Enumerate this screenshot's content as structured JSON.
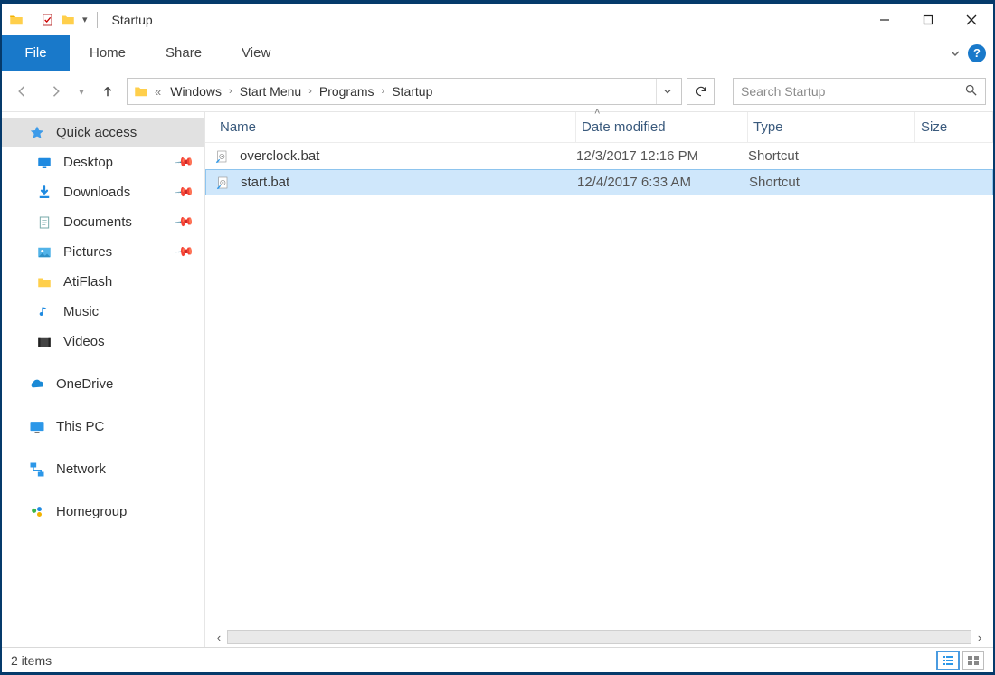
{
  "window": {
    "title": "Startup"
  },
  "ribbon": {
    "file": "File",
    "tabs": [
      "Home",
      "Share",
      "View"
    ]
  },
  "breadcrumbs": [
    "Windows",
    "Start Menu",
    "Programs",
    "Startup"
  ],
  "search": {
    "placeholder": "Search Startup"
  },
  "navpane": {
    "quick_access": "Quick access",
    "items": [
      {
        "label": "Desktop",
        "pinned": true
      },
      {
        "label": "Downloads",
        "pinned": true
      },
      {
        "label": "Documents",
        "pinned": true
      },
      {
        "label": "Pictures",
        "pinned": true
      },
      {
        "label": "AtiFlash",
        "pinned": false
      },
      {
        "label": "Music",
        "pinned": false
      },
      {
        "label": "Videos",
        "pinned": false
      }
    ],
    "onedrive": "OneDrive",
    "thispc": "This PC",
    "network": "Network",
    "homegroup": "Homegroup"
  },
  "columns": {
    "name": "Name",
    "date": "Date modified",
    "type": "Type",
    "size": "Size"
  },
  "files": [
    {
      "name": "overclock.bat",
      "date": "12/3/2017 12:16 PM",
      "type": "Shortcut",
      "selected": false
    },
    {
      "name": "start.bat",
      "date": "12/4/2017 6:33 AM",
      "type": "Shortcut",
      "selected": true
    }
  ],
  "status": {
    "text": "2 items"
  }
}
